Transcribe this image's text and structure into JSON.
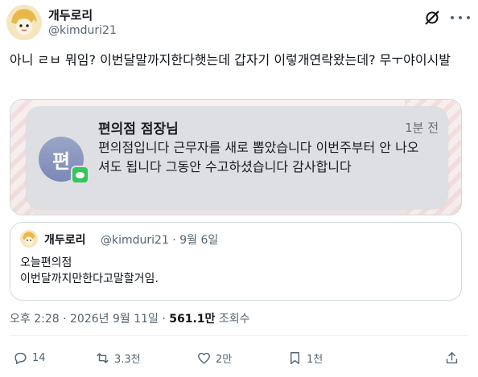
{
  "author": {
    "name": "개두로리",
    "handle": "@kimduri21"
  },
  "tweet": {
    "text": "아니 ㄹㅂ 뭐임? 이번달말까지한다햇는데 갑자기 이렇개연락왔는데? 무ㅜ야이시발"
  },
  "notification": {
    "sender_initial": "편",
    "title": "편의점 점장님",
    "time": "1분 전",
    "body": "편의점입니다 근무자를 새로 뽑았습니다 이번주부터 안 나오셔도 됩니다 그동안 수고하셨습니다 감사합니다"
  },
  "quoted_tweet": {
    "name": "개두로리",
    "meta": "@kimduri21 · 9월 6일",
    "line1": "오늘편의점",
    "line2": "이번달까지만한다고말할거임."
  },
  "stats": {
    "datetime": "오후 2:28 · 2026년 9월 11일 · ",
    "views_count": "561.1만",
    "views_label": " 조회수"
  },
  "actions": {
    "reply_count": "14",
    "retweet_count": "3.3천",
    "like_count": "2만",
    "bookmark_count": "1천"
  },
  "colors": {
    "text_primary": "#0f1419",
    "text_secondary": "#536471",
    "border": "#cfd9de",
    "notification_bg": "#dedfe3",
    "message_green": "#34c759"
  },
  "icons": [
    "grok-icon",
    "more-icon",
    "reply-icon",
    "retweet-icon",
    "like-icon",
    "bookmark-icon",
    "share-icon",
    "message-app-icon"
  ]
}
